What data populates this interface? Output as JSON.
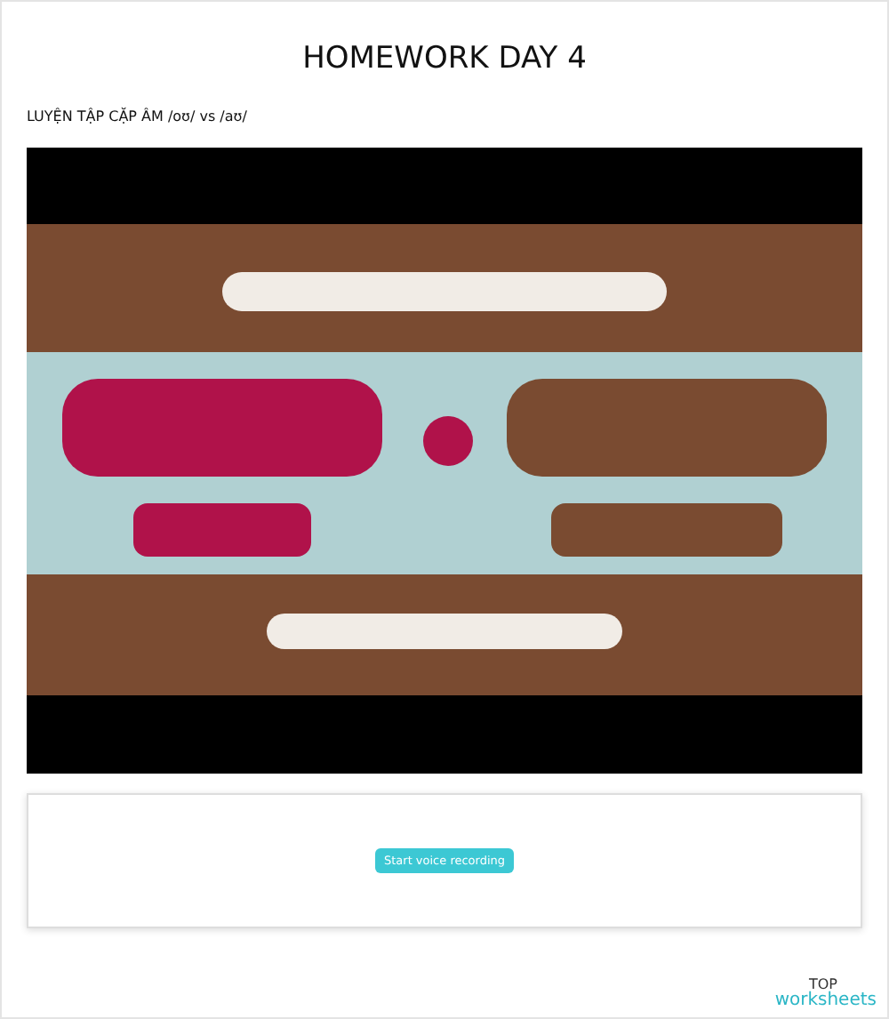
{
  "title": "HOMEWORK DAY 4",
  "subtitle": "LUYỆN TẬP CẶP ÂM /oʊ/ vs /aʊ/",
  "recorder": {
    "button": "Start voice recording"
  },
  "logo": {
    "top": "TOP",
    "bottom": "worksheets"
  }
}
